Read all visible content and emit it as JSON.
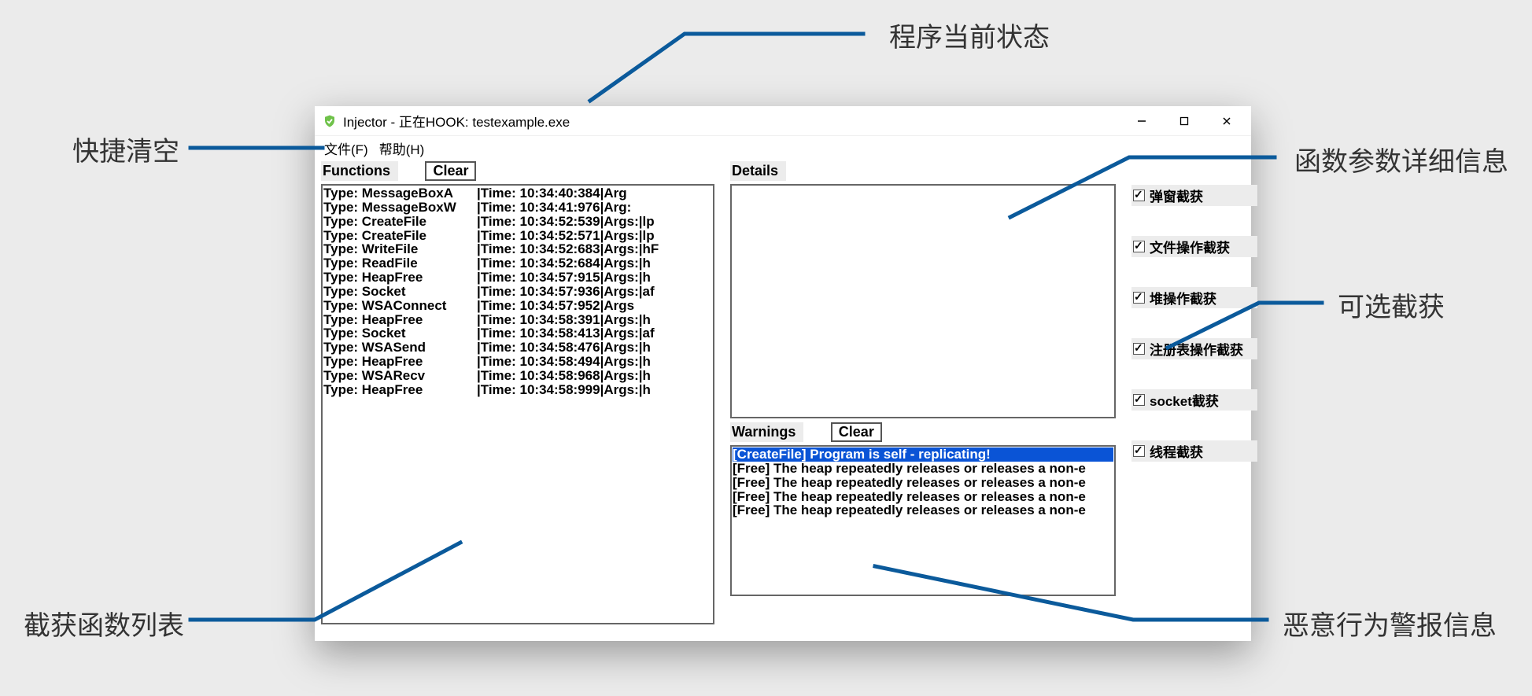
{
  "window": {
    "title": "Injector - 正在HOOK: testexample.exe",
    "menu": {
      "file": "文件(F)",
      "help": "帮助(H)"
    }
  },
  "panels": {
    "functions": {
      "label": "Functions",
      "clear": "Clear"
    },
    "details": {
      "label": "Details"
    },
    "warnings": {
      "label": "Warnings",
      "clear": "Clear"
    }
  },
  "functions": [
    {
      "type": "Type: MessageBoxA",
      "rest": "|Time: 10:34:40:384|Arg"
    },
    {
      "type": "Type: MessageBoxW",
      "rest": "|Time: 10:34:41:976|Arg:"
    },
    {
      "type": "Type: CreateFile",
      "rest": "|Time: 10:34:52:539|Args:|lp"
    },
    {
      "type": "Type: CreateFile",
      "rest": "|Time: 10:34:52:571|Args:|lp"
    },
    {
      "type": "Type: WriteFile",
      "rest": "|Time: 10:34:52:683|Args:|hF"
    },
    {
      "type": "Type: ReadFile",
      "rest": "|Time: 10:34:52:684|Args:|h"
    },
    {
      "type": "Type: HeapFree",
      "rest": "|Time: 10:34:57:915|Args:|h"
    },
    {
      "type": "Type: Socket",
      "rest": "|Time: 10:34:57:936|Args:|af"
    },
    {
      "type": "Type: WSAConnect",
      "rest": "|Time: 10:34:57:952|Args"
    },
    {
      "type": "Type: HeapFree",
      "rest": "|Time: 10:34:58:391|Args:|h"
    },
    {
      "type": "Type: Socket",
      "rest": "|Time: 10:34:58:413|Args:|af"
    },
    {
      "type": "Type: WSASend",
      "rest": "|Time: 10:34:58:476|Args:|h"
    },
    {
      "type": "Type: HeapFree",
      "rest": "|Time: 10:34:58:494|Args:|h"
    },
    {
      "type": "Type: WSARecv",
      "rest": "|Time: 10:34:58:968|Args:|h"
    },
    {
      "type": "Type: HeapFree",
      "rest": "|Time: 10:34:58:999|Args:|h"
    }
  ],
  "warnings": [
    {
      "text": "[CreateFile] Program is self - replicating!",
      "selected": true
    },
    {
      "text": "[Free] The heap repeatedly releases or releases a non-e",
      "selected": false
    },
    {
      "text": "[Free] The heap repeatedly releases or releases a non-e",
      "selected": false
    },
    {
      "text": "[Free] The heap repeatedly releases or releases a non-e",
      "selected": false
    },
    {
      "text": "[Free] The heap repeatedly releases or releases a non-e",
      "selected": false
    }
  ],
  "checks": [
    {
      "label": "弹窗截获",
      "checked": true
    },
    {
      "label": "文件操作截获",
      "checked": true
    },
    {
      "label": "堆操作截获",
      "checked": true
    },
    {
      "label": "注册表操作截获",
      "checked": true
    },
    {
      "label": "socket截获",
      "checked": true
    },
    {
      "label": "线程截获",
      "checked": true
    }
  ],
  "annos": {
    "status": "程序当前状态",
    "clear": "快捷清空",
    "funclist": "截获函数列表",
    "details": "函数参数详细信息",
    "options": "可选截获",
    "warnings": "恶意行为警报信息"
  }
}
